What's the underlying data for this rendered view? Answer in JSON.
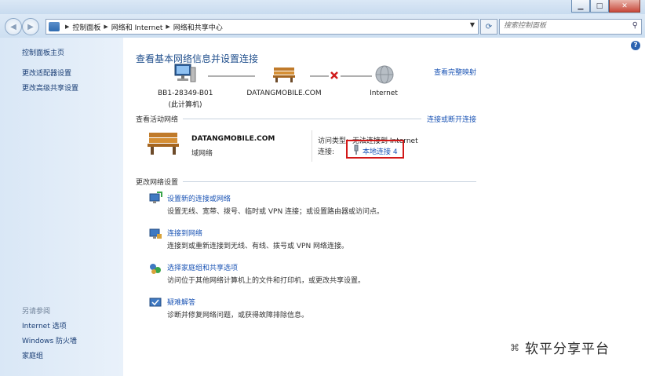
{
  "window": {
    "minimize": "▁",
    "maximize": "□",
    "close": "✕"
  },
  "nav": {
    "back_icon": "back-arrow-icon",
    "forward_icon": "forward-arrow-icon",
    "breadcrumbs": [
      "控制面板",
      "网络和 Internet",
      "网络和共享中心"
    ],
    "search_placeholder": "搜索控制面板"
  },
  "sidebar": {
    "items": [
      "控制面板主页",
      "更改适配器设置",
      "更改高级共享设置"
    ],
    "see_also_title": "另请参阅",
    "see_also": [
      "Internet 选项",
      "Windows 防火墙",
      "家庭组"
    ]
  },
  "main": {
    "title": "查看基本网络信息并设置连接",
    "see_full_map": "查看完整映射",
    "nodes": [
      {
        "label": "BB1-28349-B01",
        "sublabel": "(此计算机)"
      },
      {
        "label": "DATANGMOBILE.COM"
      },
      {
        "label": "Internet"
      }
    ],
    "active_section": "查看活动网络",
    "connect_disconnect": "连接或断开连接",
    "network": {
      "name": "DATANGMOBILE.COM",
      "type": "域网络",
      "access_label": "访问类型:",
      "access_value": "无法连接到 Internet",
      "conn_label": "连接:",
      "conn_value": "本地连接 4"
    },
    "change_section": "更改网络设置",
    "tasks": [
      {
        "link": "设置新的连接或网络",
        "desc": "设置无线、宽带、拨号、临时或 VPN 连接；或设置路由器或访问点。"
      },
      {
        "link": "连接到网络",
        "desc": "连接到或重新连接到无线、有线、拨号或 VPN 网络连接。"
      },
      {
        "link": "选择家庭组和共享选项",
        "desc": "访问位于其他网络计算机上的文件和打印机，或更改共享设置。"
      },
      {
        "link": "疑难解答",
        "desc": "诊断并修复网络问题，或获得故障排除信息。"
      }
    ]
  },
  "watermark": {
    "text": "软平分享平台"
  },
  "colors": {
    "link": "#1c55b5",
    "title": "#1f4e8c",
    "highlight_box": "#d21818"
  }
}
